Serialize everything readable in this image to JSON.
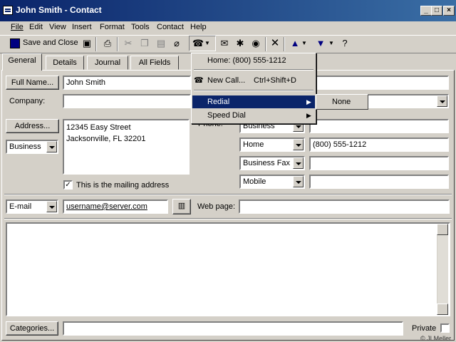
{
  "window": {
    "title": "John Smith - Contact"
  },
  "menu": [
    "File",
    "Edit",
    "View",
    "Insert",
    "Format",
    "Tools",
    "Contact",
    "Help"
  ],
  "toolbar": {
    "save_close": "Save and Close"
  },
  "tabs": [
    "General",
    "Details",
    "Journal",
    "All Fields"
  ],
  "form": {
    "full_name_btn": "Full Name...",
    "full_name": "John Smith",
    "company_label": "Company:",
    "company": "",
    "address_btn": "Address...",
    "address_type": "Business",
    "address_line1": "12345 Easy Street",
    "address_line2": "Jacksonville, FL  32201",
    "mailing_label": "This is the mailing address",
    "phone_label": "Phone:",
    "phones": [
      {
        "type": "Business",
        "value": ""
      },
      {
        "type": "Home",
        "value": "(800) 555-1212"
      },
      {
        "type": "Business Fax",
        "value": ""
      },
      {
        "type": "Mobile",
        "value": ""
      }
    ],
    "email_type": "E-mail",
    "email": "username@server.com",
    "webpage_label": "Web page:",
    "webpage": "",
    "categories_btn": "Categories...",
    "categories": "",
    "private_label": "Private",
    "watermark": "© JLMeller"
  },
  "dropdown": {
    "home": "Home: (800) 555-1212",
    "new_call": "New Call...",
    "new_call_shortcut": "Ctrl+Shift+D",
    "redial": "Redial",
    "speed_dial": "Speed Dial",
    "submenu_none": "None"
  }
}
